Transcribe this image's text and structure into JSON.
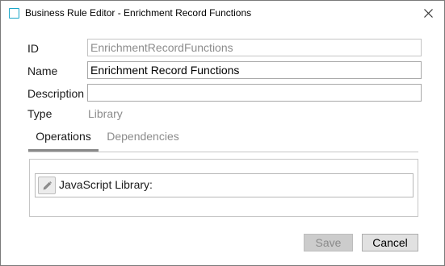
{
  "window": {
    "title": "Business Rule Editor - Enrichment Record Functions",
    "close_icon": "close-icon"
  },
  "form": {
    "id_label": "ID",
    "id_value": "EnrichmentRecordFunctions",
    "name_label": "Name",
    "name_value": "Enrichment Record Functions",
    "description_label": "Description",
    "description_value": "",
    "type_label": "Type",
    "type_value": "Library"
  },
  "tabs": [
    {
      "label": "Operations",
      "selected": true
    },
    {
      "label": "Dependencies",
      "selected": false
    }
  ],
  "operations": [
    {
      "label": "JavaScript Library:",
      "icon": "pencil-icon"
    }
  ],
  "buttons": {
    "save_label": "Save",
    "save_enabled": false,
    "cancel_label": "Cancel"
  },
  "colors": {
    "app_icon_border": "#1aa6c8",
    "disabled_text": "#8c8c8c"
  }
}
